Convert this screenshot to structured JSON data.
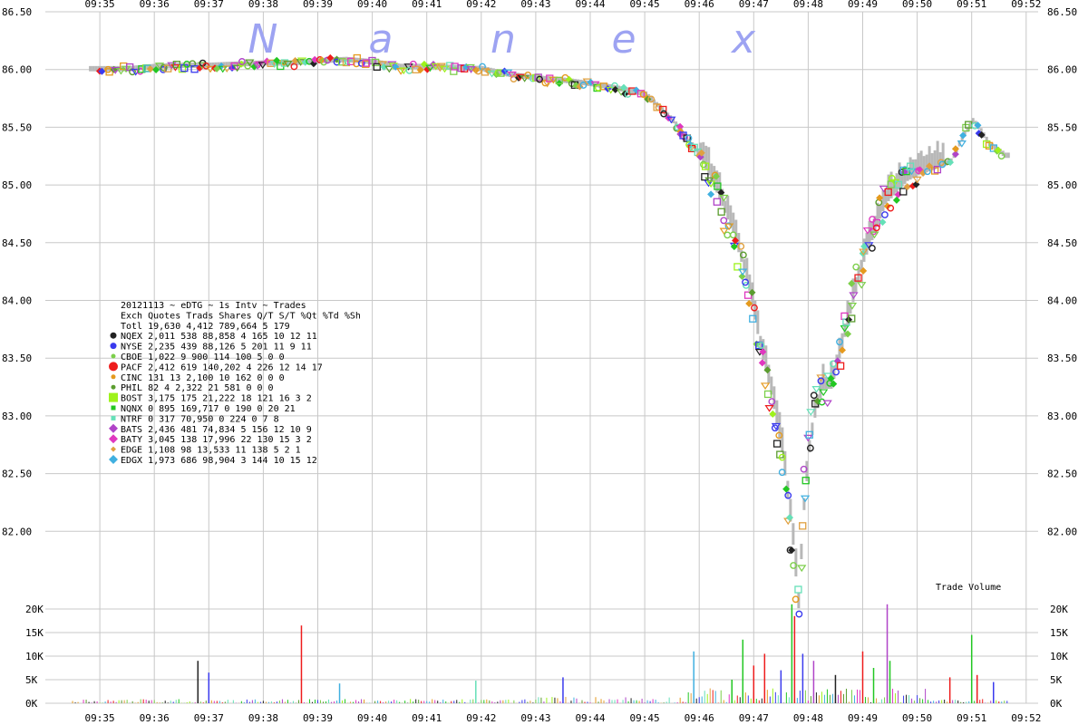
{
  "chart_data": {
    "type": "scatter",
    "watermark_letters": [
      "N",
      "a",
      "n",
      "e",
      "x"
    ],
    "x_ticks": [
      "09:35",
      "09:36",
      "09:37",
      "09:38",
      "09:39",
      "09:40",
      "09:41",
      "09:42",
      "09:43",
      "09:44",
      "09:45",
      "09:46",
      "09:47",
      "09:48",
      "09:49",
      "09:50",
      "09:51",
      "09:52"
    ],
    "price": {
      "ylim": [
        81.5,
        86.5
      ],
      "y_ticks": [
        "86.50",
        "86.00",
        "85.50",
        "85.00",
        "84.50",
        "84.00",
        "83.50",
        "83.00",
        "82.50",
        "82.00"
      ],
      "path_minutes": [
        0,
        0.5,
        1,
        1.5,
        2,
        2.5,
        3,
        3.5,
        4,
        4.5,
        5,
        5.5,
        6,
        6.5,
        7,
        7.5,
        8,
        8.5,
        9,
        9.5,
        10,
        10.5,
        11,
        11.3,
        11.6,
        11.9,
        12.1,
        12.3,
        12.5,
        12.6,
        12.7,
        12.8,
        12.9,
        13.0,
        13.1,
        13.25,
        13.4,
        13.6,
        13.8,
        14.0,
        14.2,
        14.4,
        14.6,
        14.8,
        15,
        15.3,
        15.6,
        15.8,
        16.0,
        16.1,
        16.3,
        16.6
      ],
      "path_values": [
        86.0,
        86.0,
        86.02,
        86.03,
        86.03,
        86.04,
        86.05,
        86.05,
        86.07,
        86.08,
        86.06,
        86.02,
        86.02,
        86.01,
        86.0,
        85.95,
        85.92,
        85.9,
        85.87,
        85.83,
        85.78,
        85.55,
        85.25,
        84.95,
        84.6,
        84.1,
        83.6,
        83.2,
        82.7,
        82.3,
        81.9,
        81.35,
        82.2,
        82.7,
        83.0,
        83.25,
        83.25,
        83.6,
        84.0,
        84.35,
        84.6,
        84.85,
        84.95,
        85.05,
        85.1,
        85.15,
        85.2,
        85.4,
        85.55,
        85.5,
        85.35,
        85.25
      ],
      "series_colors": [
        "#222222",
        "#3a3aee",
        "#7ccf4a",
        "#ee1c1c",
        "#e59a1e",
        "#5b9d2f",
        "#9ef21c",
        "#22c722",
        "#66e0b8",
        "#b044c8",
        "#e038c0",
        "#e0a040",
        "#40b0e0"
      ]
    },
    "volume": {
      "title": "Trade Volume",
      "ylim": [
        0,
        21000
      ],
      "y_ticks": [
        {
          "v": 20000,
          "label": "20K"
        },
        {
          "v": 15000,
          "label": "15K"
        },
        {
          "v": 10000,
          "label": "10K"
        },
        {
          "v": 5000,
          "label": "5K"
        },
        {
          "v": 0,
          "label": "0K"
        }
      ],
      "spikes": [
        {
          "m": 1.8,
          "v": 9000,
          "c": "#222222"
        },
        {
          "m": 2.0,
          "v": 6500,
          "c": "#3a3aee"
        },
        {
          "m": 3.7,
          "v": 16500,
          "c": "#ee1c1c"
        },
        {
          "m": 4.4,
          "v": 4200,
          "c": "#40b0e0"
        },
        {
          "m": 6.9,
          "v": 4800,
          "c": "#66e0b8"
        },
        {
          "m": 8.5,
          "v": 5500,
          "c": "#3a3aee"
        },
        {
          "m": 10.9,
          "v": 11000,
          "c": "#40b0e0"
        },
        {
          "m": 11.6,
          "v": 5000,
          "c": "#22c722"
        },
        {
          "m": 11.8,
          "v": 13500,
          "c": "#22c722"
        },
        {
          "m": 12.0,
          "v": 8000,
          "c": "#ee1c1c"
        },
        {
          "m": 12.2,
          "v": 10500,
          "c": "#ee1c1c"
        },
        {
          "m": 12.5,
          "v": 7000,
          "c": "#3a3aee"
        },
        {
          "m": 12.7,
          "v": 21000,
          "c": "#22c722"
        },
        {
          "m": 12.75,
          "v": 18500,
          "c": "#ee1c1c"
        },
        {
          "m": 12.9,
          "v": 10500,
          "c": "#3a3aee"
        },
        {
          "m": 13.1,
          "v": 9000,
          "c": "#b044c8"
        },
        {
          "m": 13.5,
          "v": 6000,
          "c": "#222222"
        },
        {
          "m": 14.0,
          "v": 11000,
          "c": "#ee1c1c"
        },
        {
          "m": 14.2,
          "v": 7500,
          "c": "#22c722"
        },
        {
          "m": 14.45,
          "v": 21500,
          "c": "#b044c8"
        },
        {
          "m": 14.5,
          "v": 9000,
          "c": "#22c722"
        },
        {
          "m": 15.6,
          "v": 5500,
          "c": "#ee1c1c"
        },
        {
          "m": 16.0,
          "v": 14500,
          "c": "#22c722"
        },
        {
          "m": 16.1,
          "v": 6000,
          "c": "#ee1c1c"
        },
        {
          "m": 16.4,
          "v": 4500,
          "c": "#3a3aee"
        }
      ]
    },
    "legend": {
      "title": "20121113 ~ eDTG ~ 1s Intv ~ Trades",
      "header": "Exch Quotes Trads  Shares  Q/T   S/T  %Qt %Td %Sh",
      "total_row": "Totl 19,630 4,412 789,664    5   179",
      "rows": [
        {
          "text": "NQEX  2,011   538  88,858    4   165  10  12  11",
          "color": "#222222",
          "marker": "circle"
        },
        {
          "text": "NYSE  2,235   439  88,126    5   201  11   9  11",
          "color": "#3a3aee",
          "marker": "circle"
        },
        {
          "text": "CBOE  1,022     9     900  114   100   5   0   0",
          "color": "#7ccf4a",
          "marker": "dot"
        },
        {
          "text": "PACF  2,412   619 140,202    4   226  12  14  17",
          "color": "#ee1c1c",
          "marker": "big-circle"
        },
        {
          "text": "CINC    131    13   2,100   10   162   0   0   0",
          "color": "#e59a1e",
          "marker": "dot"
        },
        {
          "text": "PHIL     82     4   2,322   21   581   0   0   0",
          "color": "#5b9d2f",
          "marker": "dot"
        },
        {
          "text": "BOST  3,175   175  21,222   18   121  16   3   2",
          "color": "#9ef21c",
          "marker": "big-square"
        },
        {
          "text": "NQNX      0   895 169,717    0   190   0  20  21",
          "color": "#22c722",
          "marker": "square"
        },
        {
          "text": "NTRF      0   317  70,950    0   224   0   7   8",
          "color": "#66e0b8",
          "marker": "square"
        },
        {
          "text": "BATS  2,436   481  74,834    5   156  12  10   9",
          "color": "#b044c8",
          "marker": "diamond"
        },
        {
          "text": "BATY  3,045   138  17,996   22   130  15   3   2",
          "color": "#e038c0",
          "marker": "diamond"
        },
        {
          "text": "EDGE  1,108    98  13,533   11   138   5   2   1",
          "color": "#e0a040",
          "marker": "small-diamond"
        },
        {
          "text": "EDGX  1,973   686  98,904    3   144  10  15  12",
          "color": "#40b0e0",
          "marker": "diamond"
        }
      ]
    }
  }
}
